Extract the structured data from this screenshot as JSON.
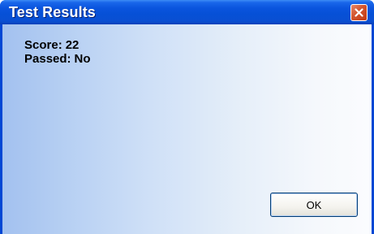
{
  "window": {
    "title": "Test Results"
  },
  "results": {
    "score_label": "Score:",
    "score_value": "22",
    "passed_label": "Passed:",
    "passed_value": "No"
  },
  "buttons": {
    "ok_label": "OK",
    "close_icon": "close-icon"
  },
  "colors": {
    "titlebar": "#0a54de",
    "close_button": "#d2542e",
    "client_gradient_left": "#a3c1ef",
    "client_gradient_right": "#fbfcfe"
  }
}
